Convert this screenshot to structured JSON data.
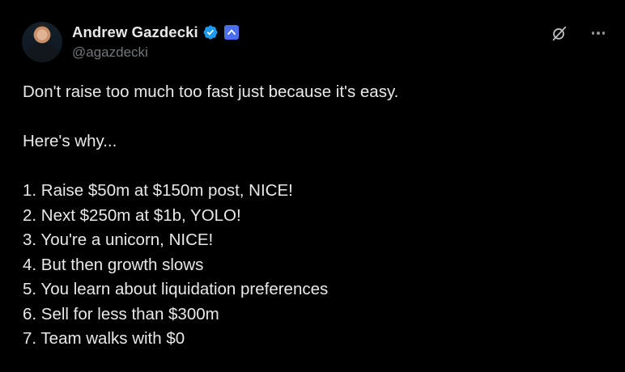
{
  "author": {
    "display_name": "Andrew Gazdecki",
    "handle": "@agazdecki",
    "verified_color": "#1d9bf0",
    "affiliate_badge_color": "#4c6ef5"
  },
  "icons": {
    "grok": "grok-icon",
    "more": "more-options-icon",
    "verified": "verified-badge-icon",
    "affiliate": "affiliate-badge-icon"
  },
  "tweet": {
    "line1": "Don't raise too much too fast just because it's easy.",
    "line2": "Here's why...",
    "list": [
      "1. Raise $50m at $150m post, NICE!",
      "2. Next $250m at $1b, YOLO!",
      "3. You're a unicorn, NICE!",
      "4. But then growth slows",
      "5. You learn about liquidation preferences",
      "6. Sell for less than $300m",
      "7. Team walks with $0"
    ]
  }
}
